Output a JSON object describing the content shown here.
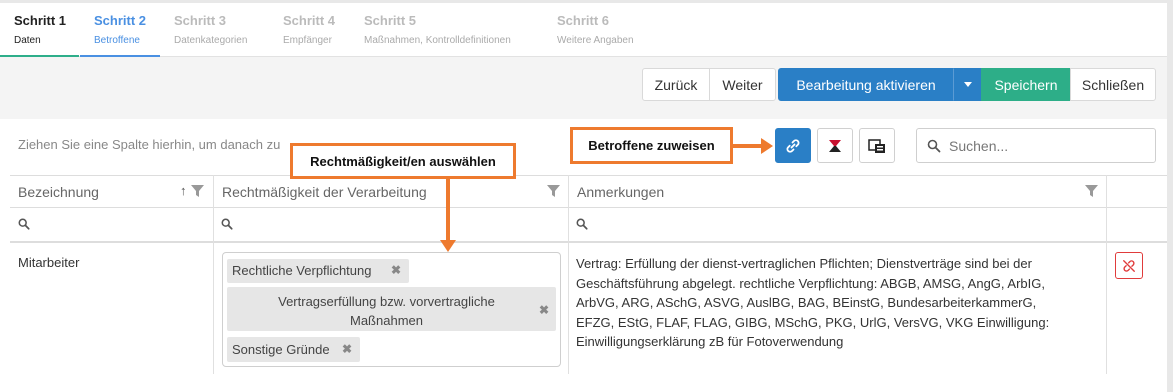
{
  "steps": [
    {
      "title": "Schritt 1",
      "subtitle": "Daten",
      "state": "done"
    },
    {
      "title": "Schritt 2",
      "subtitle": "Betroffene",
      "state": "active"
    },
    {
      "title": "Schritt 3",
      "subtitle": "Datenkategorien",
      "state": "pending"
    },
    {
      "title": "Schritt 4",
      "subtitle": "Empfänger",
      "state": "pending"
    },
    {
      "title": "Schritt 5",
      "subtitle": "Maßnahmen, Kontrolldefinitionen",
      "state": "pending"
    },
    {
      "title": "Schritt 6",
      "subtitle": "Weitere Angaben",
      "state": "pending"
    }
  ],
  "toolbar": {
    "back": "Zurück",
    "next": "Weiter",
    "enable_edit": "Bearbeitung aktivieren",
    "save": "Speichern",
    "close": "Schließen"
  },
  "grid": {
    "group_hint": "Ziehen Sie eine Spalte hierhin, um danach zu",
    "search_placeholder": "Suchen...",
    "columns": [
      "Bezeichnung",
      "Rechtmäßigkeit der Verarbeitung",
      "Anmerkungen"
    ],
    "row": {
      "name": "Mitarbeiter",
      "lawfulness_tags": [
        "Rechtliche Verpflichtung",
        "Vertragserfüllung bzw. vorvertragliche Maßnahmen",
        "Sonstige Gründe"
      ],
      "notes": "Vertrag: Erfüllung der dienst-vertraglichen Pflichten; Dienstverträge sind bei der Geschäftsführung abgelegt. rechtliche Verpflichtung: ABGB, AMSG, AngG, ArbIG, ArbVG, ARG, ASchG, ASVG, AuslBG, BAG, BEinstG, BundesarbeiterkammerG, EFZG, EStG, FLAF, FLAG, GIBG, MSchG, PKG, UrlG, VersVG, VKG Einwilligung: Einwilligungserklärung zB für Fotoverwendung"
    }
  },
  "callouts": {
    "assign": "Betroffene zuweisen",
    "lawfulness": "Rechtmäßigkeit/en auswählen"
  },
  "colors": {
    "primary": "#2a7fc6",
    "success": "#2dae88",
    "active_step": "#4a90e2",
    "callout": "#ee7a2e",
    "danger": "#e03b3b"
  }
}
